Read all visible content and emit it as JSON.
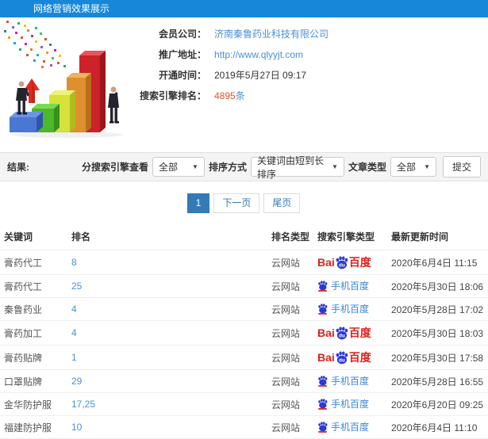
{
  "header": {
    "title": "网络营销效果展示"
  },
  "colors": {
    "header_bg": "#1787d9",
    "link_blue": "#4a90d9",
    "highlight_red": "#e8502a",
    "baidu_red": "#d9241c",
    "baidu_blue": "#2c39d8",
    "pagination_active": "#337ab7"
  },
  "info": {
    "rows": [
      {
        "label": "会员公司：",
        "value": "济南秦鲁药业科技有限公司"
      },
      {
        "label": "推广地址：",
        "value": "http://www.qlyyjt.com"
      },
      {
        "label": "开通时间：",
        "value": "2019年5月27日 09:17"
      },
      {
        "label": "搜索引擎排名：",
        "value": "4895",
        "suffix": "条"
      }
    ]
  },
  "filters": {
    "result_label": "结果:",
    "engine_label": "分搜索引擎查看",
    "engine_value": "全部",
    "sort_label": "排序方式",
    "sort_value": "关键词由短到长排序",
    "article_label": "文章类型",
    "article_value": "全部",
    "submit_label": "提交"
  },
  "pagination": {
    "current": "1",
    "next": "下一页",
    "last": "尾页"
  },
  "logos": {
    "baidu": {
      "prefix": "Bai",
      "paw_text": "du",
      "suffix": "百度"
    },
    "mobile_baidu": {
      "label": "手机百度"
    }
  },
  "table": {
    "headers": [
      "关键词",
      "排名",
      "排名类型",
      "搜索引擎类型",
      "最新更新时间"
    ],
    "rows": [
      {
        "keyword": "膏药代工",
        "rank": "8",
        "rank_type": "云网站",
        "engine": "baidu",
        "updated": "2020年6月4日 11:15"
      },
      {
        "keyword": "膏药代工",
        "rank": "25",
        "rank_type": "云网站",
        "engine": "mobile-baidu",
        "updated": "2020年5月30日 18:06"
      },
      {
        "keyword": "秦鲁药业",
        "rank": "4",
        "rank_type": "云网站",
        "engine": "mobile-baidu",
        "updated": "2020年5月28日 17:02"
      },
      {
        "keyword": "膏药加工",
        "rank": "4",
        "rank_type": "云网站",
        "engine": "baidu",
        "updated": "2020年5月30日 18:03"
      },
      {
        "keyword": "膏药贴牌",
        "rank": "1",
        "rank_type": "云网站",
        "engine": "baidu",
        "updated": "2020年5月30日 17:58"
      },
      {
        "keyword": "口罩贴牌",
        "rank": "29",
        "rank_type": "云网站",
        "engine": "mobile-baidu",
        "updated": "2020年5月28日 16:55"
      },
      {
        "keyword": "金华防护服",
        "rank": "17,25",
        "rank_type": "云网站",
        "engine": "mobile-baidu",
        "updated": "2020年6月20日 09:25"
      },
      {
        "keyword": "福建防护服",
        "rank": "10",
        "rank_type": "云网站",
        "engine": "mobile-baidu",
        "updated": "2020年6月4日 11:10"
      }
    ]
  }
}
